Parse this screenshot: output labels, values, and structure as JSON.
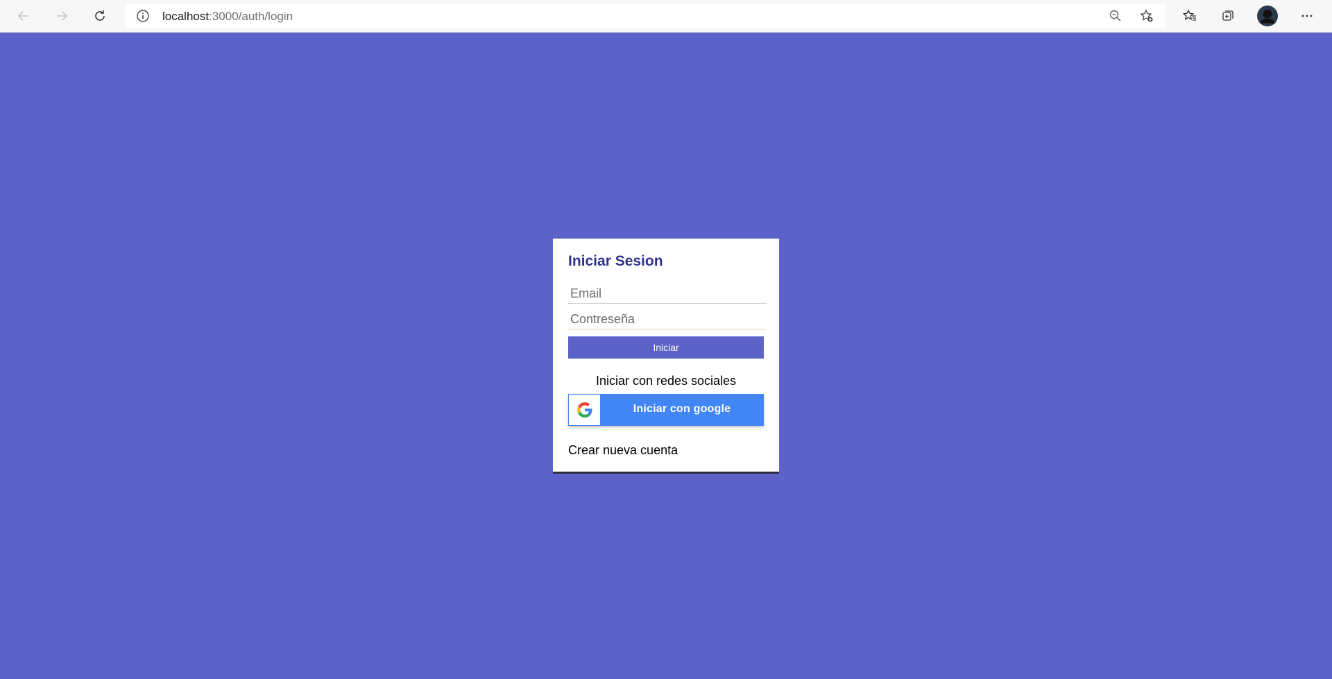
{
  "browser": {
    "url_host": "localhost",
    "url_rest": ":3000/auth/login"
  },
  "login": {
    "title": "Iniciar Sesion",
    "email_placeholder": "Email",
    "password_placeholder": "Contreseña",
    "submit_label": "Iniciar",
    "social_label": "Iniciar con redes sociales",
    "google_label": "Iniciar con google",
    "register_link": "Crear nueva cuenta"
  },
  "colors": {
    "background": "#5c62c7",
    "title": "#2e3188",
    "google_blue": "#4285f4"
  },
  "icons": {
    "back": "arrow-left-icon",
    "forward": "arrow-right-icon",
    "refresh": "refresh-icon",
    "info": "info-icon",
    "zoom": "zoom-out-icon",
    "favorite_add": "star-plus-icon",
    "favorites": "favorites-list-icon",
    "collections": "collections-icon",
    "profile": "avatar",
    "menu": "more-icon",
    "google": "google-logo-icon"
  }
}
